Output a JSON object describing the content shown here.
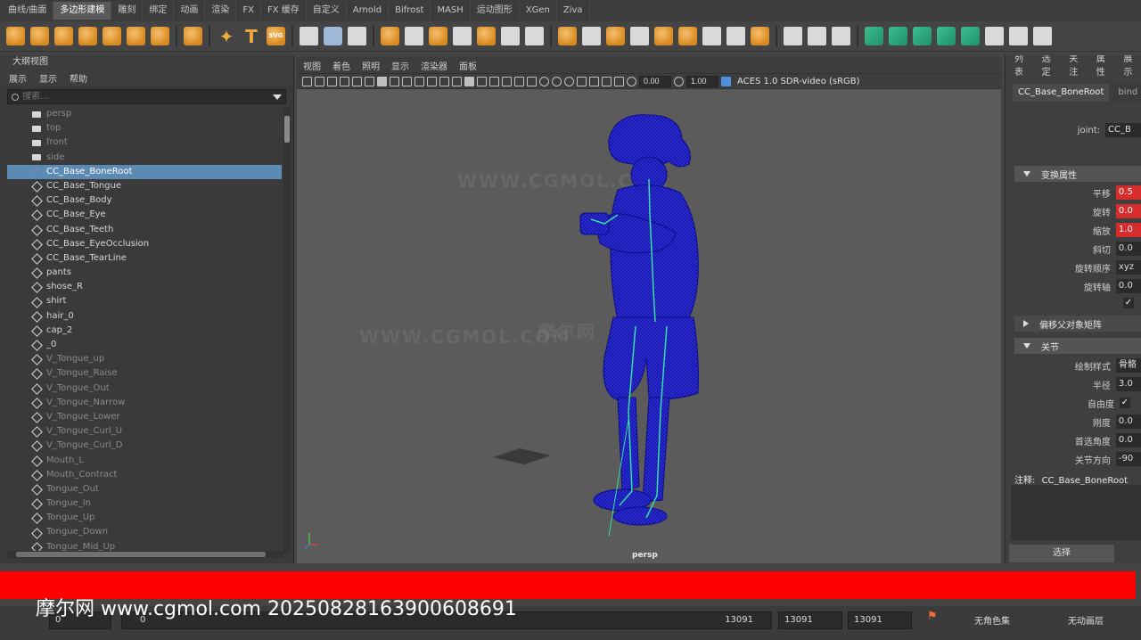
{
  "shelf_tabs": [
    "曲线/曲面",
    "多边形建模",
    "雕刻",
    "绑定",
    "动画",
    "渲染",
    "FX",
    "FX 缓存",
    "自定义",
    "Arnold",
    "Bifrost",
    "MASH",
    "运动图形",
    "XGen",
    "Ziva"
  ],
  "shelf_active_tab": "多边形建模",
  "shelf_icons": [
    "sphere-icon",
    "cube-icon",
    "cylinder-icon",
    "cone-icon",
    "torus-icon",
    "plane-icon",
    "disc-icon",
    "soccer-ball-icon",
    "star-icon",
    "text-icon",
    "svg-icon",
    "measure-icon",
    "align-icon",
    "snap-icon"
  ],
  "shelf_svg_label": "SVG",
  "outliner": {
    "title": "大纲视图",
    "menu": [
      "展示",
      "显示",
      "帮助"
    ],
    "search_placeholder": "搜索...",
    "items": [
      {
        "label": "persp",
        "type": "cam",
        "state": "dim"
      },
      {
        "label": "top",
        "type": "cam",
        "state": "dim"
      },
      {
        "label": "front",
        "type": "cam",
        "state": "dim"
      },
      {
        "label": "side",
        "type": "cam",
        "state": "dim"
      },
      {
        "label": "CC_Base_BoneRoot",
        "type": "joint",
        "state": "selected"
      },
      {
        "label": "CC_Base_Tongue",
        "type": "mesh",
        "state": "normal"
      },
      {
        "label": "CC_Base_Body",
        "type": "mesh",
        "state": "normal"
      },
      {
        "label": "CC_Base_Eye",
        "type": "mesh",
        "state": "normal"
      },
      {
        "label": "CC_Base_Teeth",
        "type": "mesh",
        "state": "normal"
      },
      {
        "label": "CC_Base_EyeOcclusion",
        "type": "mesh",
        "state": "normal"
      },
      {
        "label": "CC_Base_TearLine",
        "type": "mesh",
        "state": "normal"
      },
      {
        "label": "pants",
        "type": "mesh",
        "state": "normal"
      },
      {
        "label": "shose_R",
        "type": "mesh",
        "state": "normal"
      },
      {
        "label": "shirt",
        "type": "mesh",
        "state": "normal"
      },
      {
        "label": "hair_0",
        "type": "mesh",
        "state": "normal"
      },
      {
        "label": "cap_2",
        "type": "mesh",
        "state": "normal"
      },
      {
        "label": "_0",
        "type": "mesh",
        "state": "normal"
      },
      {
        "label": "V_Tongue_up",
        "type": "mesh",
        "state": "dim"
      },
      {
        "label": "V_Tongue_Raise",
        "type": "mesh",
        "state": "dim"
      },
      {
        "label": "V_Tongue_Out",
        "type": "mesh",
        "state": "dim"
      },
      {
        "label": "V_Tongue_Narrow",
        "type": "mesh",
        "state": "dim"
      },
      {
        "label": "V_Tongue_Lower",
        "type": "mesh",
        "state": "dim"
      },
      {
        "label": "V_Tongue_Curl_U",
        "type": "mesh",
        "state": "dim"
      },
      {
        "label": "V_Tongue_Curl_D",
        "type": "mesh",
        "state": "dim"
      },
      {
        "label": "Mouth_L",
        "type": "mesh",
        "state": "dim"
      },
      {
        "label": "Mouth_Contract",
        "type": "mesh",
        "state": "dim"
      },
      {
        "label": "Tongue_Out",
        "type": "mesh",
        "state": "dim"
      },
      {
        "label": "Tongue_In",
        "type": "mesh",
        "state": "dim"
      },
      {
        "label": "Tongue_Up",
        "type": "mesh",
        "state": "dim"
      },
      {
        "label": "Tongue_Down",
        "type": "mesh",
        "state": "dim"
      },
      {
        "label": "Tongue_Mid_Up",
        "type": "mesh",
        "state": "dim"
      }
    ]
  },
  "viewport": {
    "menu": [
      "视图",
      "着色",
      "照明",
      "显示",
      "渲染器",
      "面板"
    ],
    "field_a": "0.00",
    "field_b": "1.00",
    "colorspace": "ACES 1.0 SDR-video (sRGB)",
    "camera_label": "persp",
    "model_color": "#1a1aa8",
    "joint_color": "#36e0a0"
  },
  "attr": {
    "menu": [
      "列表",
      "选定",
      "关注",
      "属性",
      "展示"
    ],
    "tabs": [
      "CC_Base_BoneRoot",
      "bind"
    ],
    "joint_label": "joint:",
    "joint_value": "CC_B",
    "section_transform": "变换属性",
    "rows": [
      {
        "label": "平移",
        "value": "0.5",
        "red": true
      },
      {
        "label": "旋转",
        "value": "0.0",
        "red": true
      },
      {
        "label": "缩放",
        "value": "1.0",
        "red": true
      },
      {
        "label": "斜切",
        "value": "0.0",
        "red": false
      },
      {
        "label": "旋转顺序",
        "value": "xyz",
        "red": false
      },
      {
        "label": "旋转轴",
        "value": "0.0",
        "red": false
      }
    ],
    "section_offset": "偏移父对象矩阵",
    "section_joint": "关节",
    "joint_rows": [
      {
        "label": "绘制样式",
        "value": "骨骼"
      },
      {
        "label": "半径",
        "value": "3.0"
      },
      {
        "label": "自由度",
        "value": "✓"
      },
      {
        "label": "刚度",
        "value": "0.0"
      },
      {
        "label": "首选角度",
        "value": "0.0"
      },
      {
        "label": "关节方向",
        "value": "-90"
      }
    ],
    "note_label": "注释:",
    "note_name": "CC_Base_BoneRoot",
    "select_button": "选择"
  },
  "timeline": {
    "color": "#ff0000",
    "watermark": "摩尔网 www.cgmol.com 20250828163900608691"
  },
  "range": {
    "start": "0",
    "current_start": "0",
    "end_display": "13091",
    "end_a": "13091",
    "end_b": "13091",
    "char_set": "无角色集",
    "anim_layer": "无动画层"
  },
  "watermarks": [
    "WWW.CGMOL.COM",
    "摩尔网"
  ]
}
